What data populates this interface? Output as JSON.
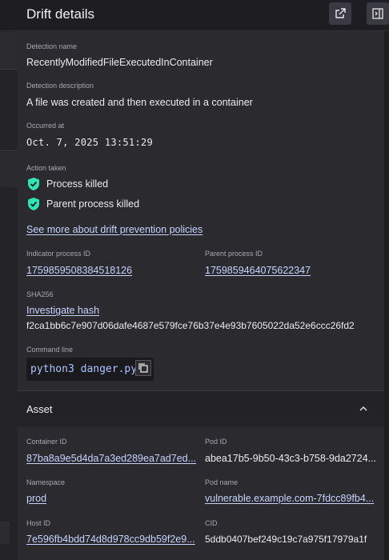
{
  "header": {
    "title": "Drift details"
  },
  "detection": {
    "name_label": "Detection name",
    "name": "RecentlyModifiedFileExecutedInContainer",
    "desc_label": "Detection description",
    "desc": "A file was created and then executed in a container",
    "occurred_label": "Occurred at",
    "occurred": "Oct. 7, 2025 13:51:29",
    "action_label": "Action taken",
    "actions": [
      "Process killed",
      "Parent process killed"
    ],
    "policy_link": "See more about drift prevention policies",
    "indicator_pid_label": "Indicator process ID",
    "indicator_pid": "1759859508384518126",
    "parent_pid_label": "Parent process ID",
    "parent_pid": "1759859464075622347",
    "sha_label": "SHA256",
    "investigate": "Investigate hash",
    "sha": "f2ca1bb6c7e907d06dafe4687e579fce76b37e4e93b7605022da52e6ccc26fd2",
    "cmd_label": "Command line",
    "cmd": "python3 danger.py"
  },
  "asset": {
    "title": "Asset",
    "container_label": "Container ID",
    "container": "87ba8a9e5d4da7a3ed289ea7ad7ed...",
    "pod_id_label": "Pod ID",
    "pod_id": "abea17b5-9b50-43c3-b758-9da2724...",
    "ns_label": "Namespace",
    "ns": "prod",
    "pod_name_label": "Pod name",
    "pod_name": "vulnerable.example.com-7fdcc89fb4...",
    "host_label": "Host ID",
    "host": "7e596fb4bdd74d8d978cc9db59f2e9...",
    "cid_label": "CID",
    "cid": "5ddb0407bef249c19c7a975f17979a1f"
  },
  "colors": {
    "shield": "#2ee6b5",
    "link": "#c6d4ff",
    "panel": "#2a2a2f"
  },
  "icons": [
    "open-external-icon",
    "collapse-panel-icon",
    "shield-check-icon",
    "copy-icon",
    "chevron-up-icon"
  ]
}
